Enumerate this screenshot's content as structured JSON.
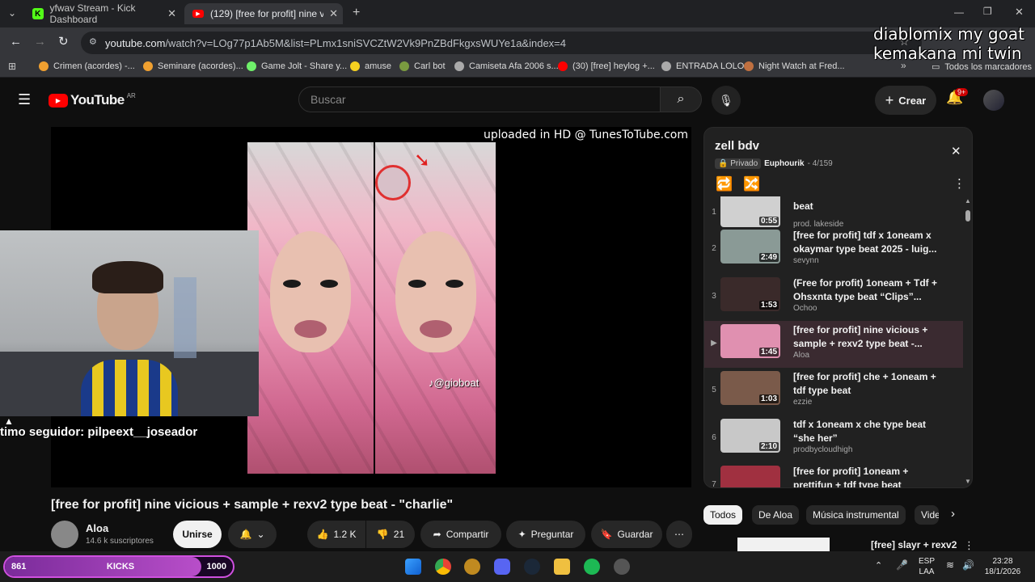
{
  "browser": {
    "tabs": [
      {
        "title": "yfwav Stream - Kick Dashboard",
        "active": false,
        "color": "#53fc18"
      },
      {
        "title": "(129) [free for profit] nine vicio",
        "active": true,
        "color": "#ff0000"
      }
    ],
    "url_domain": "youtube.com",
    "url_path": "/watch?v=LOg77p1Ab5M&list=PLmx1sniSVCZtW2Vk9PnZBdFkgxsWUYe1a&index=4",
    "bookmarks": [
      "Crimen (acordes) -...",
      "Seminare (acordes)...",
      "Game Jolt - Share y...",
      "amuse",
      "Carl bot",
      "Camiseta Afa 2006 s...",
      "(30) [free] heylog +...",
      "ENTRADA LOLO",
      "Night Watch at Fred..."
    ],
    "bookmarks_all": "Todos los marcadores"
  },
  "overlay": {
    "line1": "diablomix my goat",
    "line2": "kemakana mi twin",
    "follower": "timo seguidor: pilpeext__joseador"
  },
  "youtube": {
    "logo": "YouTube",
    "region": "AR",
    "search_placeholder": "Buscar",
    "create": "Crear",
    "notif_count": "9+"
  },
  "player": {
    "watermark": "uploaded in HD @ TunesToTube.com",
    "tiktok_tag": "@gioboat"
  },
  "video": {
    "title": "[free for profit] nine vicious + sample + rexv2 type beat - \"charlie\"",
    "channel": "Aloa",
    "subscribers": "14.6 k suscriptores",
    "join": "Unirse",
    "likes": "1.2 K",
    "dislikes": "21",
    "share": "Compartir",
    "ask": "Preguntar",
    "save": "Guardar"
  },
  "playlist": {
    "title": "zell bdv",
    "privacy": "Privado",
    "owner": "Euphourik",
    "position": "- 4/159",
    "items": [
      {
        "num": "1",
        "title": "beat",
        "channel": "prod. lakeside",
        "duration": "0:55",
        "color": "#d0d0d0"
      },
      {
        "num": "2",
        "title": "[free for profit] tdf x 1oneam x okaymar type beat 2025 - luig...",
        "channel": "sevynn",
        "duration": "2:49",
        "color": "#8a9a96"
      },
      {
        "num": "3",
        "title": "(Free for profit) 1oneam + Tdf + Ohsxnta type beat “Clips”...",
        "channel": "Ochoo",
        "duration": "1:53",
        "color": "#3a2a2a"
      },
      {
        "num": "▶",
        "title": "[free for profit] nine vicious + sample + rexv2 type beat -...",
        "channel": "Aloa",
        "duration": "1:45",
        "color": "#e090b0"
      },
      {
        "num": "5",
        "title": "[free for profit] che + 1oneam + tdf type beat",
        "channel": "ezzie",
        "duration": "1:03",
        "color": "#7a5a4a"
      },
      {
        "num": "6",
        "title": "tdf x 1oneam x che type beat “she her”",
        "channel": "prodbycloudhigh",
        "duration": "2:10",
        "color": "#c8c8c8"
      },
      {
        "num": "7",
        "title": "[free for profit] 1oneam + prettifun + tdf type beat",
        "channel": "",
        "duration": "",
        "color": "#a03040"
      }
    ]
  },
  "chips": [
    "Todos",
    "De Aloa",
    "Música instrumental",
    "Vide"
  ],
  "recommended_title": "[free] slayr + rexv2",
  "kicks": {
    "left": "861",
    "label": "KICKS",
    "right": "1000",
    "progress": 0.861
  },
  "taskbar": {
    "lang1": "ESP",
    "lang2": "LAA",
    "time": "23:28",
    "date": "18/1/2026"
  }
}
